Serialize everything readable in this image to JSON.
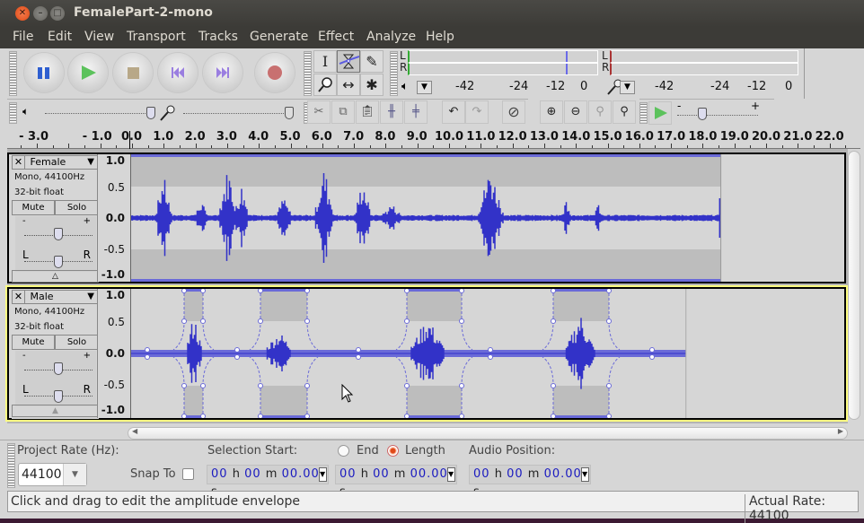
{
  "window": {
    "title": "FemalePart-2-mono"
  },
  "menu": [
    "File",
    "Edit",
    "View",
    "Transport",
    "Tracks",
    "Generate",
    "Effect",
    "Analyze",
    "Help"
  ],
  "transport": [
    {
      "name": "pause",
      "icon": "pause-icon"
    },
    {
      "name": "play",
      "icon": "play-icon"
    },
    {
      "name": "stop",
      "icon": "stop-icon"
    },
    {
      "name": "skip-start",
      "icon": "skip-to-start-icon"
    },
    {
      "name": "skip-end",
      "icon": "skip-to-end-icon"
    },
    {
      "name": "record",
      "icon": "record-icon"
    }
  ],
  "tools": {
    "selection": "I",
    "envelope": "⧗",
    "draw": "✎",
    "zoom": "⚲",
    "timeshift": "↔",
    "multi": "✱",
    "active": "envelope"
  },
  "meters": {
    "playback": {
      "channels": [
        "L",
        "R"
      ],
      "ticks": [
        "-42",
        "-24",
        "-12",
        "0"
      ],
      "peak_db": -9
    },
    "record": {
      "channels": [
        "L",
        "R"
      ],
      "ticks": [
        "-42",
        "-24",
        "-12",
        "0"
      ]
    }
  },
  "mixer": {
    "playback_volume": 1.0,
    "record_volume": 1.0
  },
  "playat_speed": {
    "min_label": "-",
    "max_label": "+",
    "value": 0.35
  },
  "ruler": {
    "labels": [
      "- 3.0",
      "- 1.0",
      "0.0",
      "1.0",
      "2.0",
      "3.0",
      "4.0",
      "5.0",
      "6.0",
      "7.0",
      "8.0",
      "9.0",
      "10.0",
      "11.0",
      "12.0",
      "13.0",
      "14.0",
      "15.0",
      "16.0",
      "17.0",
      "18.0",
      "19.0",
      "20.0",
      "21.0",
      "22.0"
    ]
  },
  "tracks": [
    {
      "name": "Female",
      "info1": "Mono, 44100Hz",
      "info2": "32-bit float",
      "mute": "Mute",
      "solo": "Solo",
      "gain_min": "-",
      "gain_max": "+",
      "pan_left": "L",
      "pan_right": "R",
      "gain": 0.5,
      "pan": 0.5,
      "vruler": [
        "1.0",
        "0.5",
        "0.0",
        "-0.5",
        "-1.0"
      ],
      "selected": false,
      "clip_end_seconds": 18.6
    },
    {
      "name": "Male",
      "info1": "Mono, 44100Hz",
      "info2": "32-bit float",
      "mute": "Mute",
      "solo": "Solo",
      "gain_min": "-",
      "gain_max": "+",
      "pan_left": "L",
      "pan_right": "R",
      "gain": 0.5,
      "pan": 0.5,
      "vruler": [
        "1.0",
        "0.5",
        "0.0",
        "-0.5",
        "-1.0"
      ],
      "selected": true,
      "clip_end_seconds": 17.5
    }
  ],
  "selection_bar": {
    "project_rate_label": "Project Rate (Hz):",
    "project_rate": "44100",
    "snap_to": "Snap To",
    "snap_checked": false,
    "selection_start_label": "Selection Start:",
    "end_label": "End",
    "length_label": "Length",
    "length_selected": true,
    "audio_position_label": "Audio Position:",
    "selection_start": {
      "h": "00",
      "m": "00",
      "s": "00.00"
    },
    "selection_length": {
      "h": "00",
      "m": "00",
      "s": "00.00"
    },
    "audio_position": {
      "h": "00",
      "m": "00",
      "s": "00.00"
    },
    "unit_h": "h",
    "unit_m": "m",
    "unit_s": "s"
  },
  "status": {
    "message": "Click and drag to edit the amplitude envelope",
    "actual_rate": "Actual Rate: 44100"
  },
  "colors": {
    "waveform": "#3232c8",
    "waveform_rms": "#6464dc",
    "selected_track_border": "#ffff80",
    "record_button": "#c87070"
  }
}
